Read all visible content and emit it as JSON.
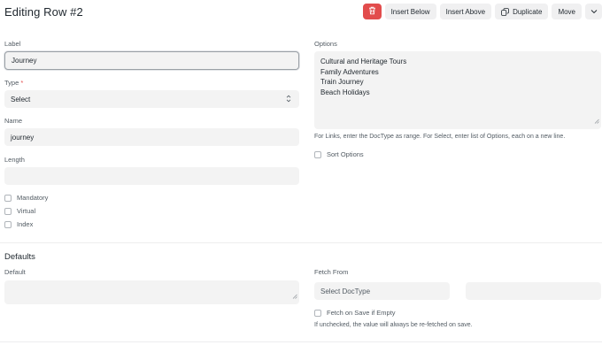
{
  "header": {
    "title": "Editing Row #2"
  },
  "toolbar": {
    "delete_icon": "trash-icon",
    "insert_below": "Insert Below",
    "insert_above": "Insert Above",
    "duplicate": "Duplicate",
    "duplicate_icon": "duplicate-icon",
    "move": "Move",
    "more_icon": "chevron-down-icon",
    "delete_color": "#e24c4c"
  },
  "form": {
    "label": {
      "title": "Label",
      "value": "Journey"
    },
    "type": {
      "title": "Type",
      "required_mark": "*",
      "value": "Select"
    },
    "name": {
      "title": "Name",
      "value": "journey"
    },
    "length": {
      "title": "Length",
      "value": ""
    },
    "mandatory": "Mandatory",
    "virtual": "Virtual",
    "index": "Index",
    "options": {
      "title": "Options",
      "values": [
        "Cultural and Heritage Tours",
        "Family Adventures",
        "Train Journey",
        "Beach Holidays"
      ],
      "help": "For Links, enter the DocType as range. For Select, enter list of Options, each on a new line."
    },
    "sort_options": "Sort Options"
  },
  "defaults": {
    "title": "Defaults",
    "default": {
      "title": "Default",
      "value": ""
    },
    "fetch_from": {
      "title": "Fetch From",
      "doctype_placeholder": "Select DocType",
      "field_value": ""
    },
    "fetch_on_save": "Fetch on Save if Empty",
    "fetch_help": "If unchecked, the value will always be re-fetched on save."
  }
}
